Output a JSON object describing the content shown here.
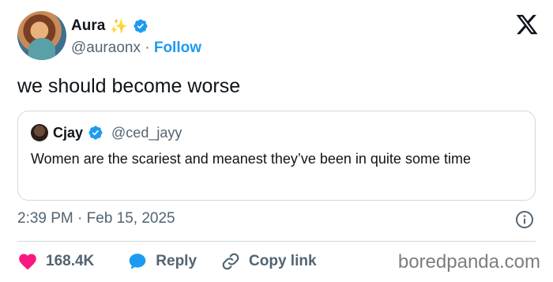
{
  "author": {
    "display_name": "Aura",
    "emoji": "✨",
    "handle": "@auraonx",
    "separator": "·",
    "follow_label": "Follow",
    "verified": true
  },
  "tweet": {
    "text": "we should become worse",
    "timestamp": "2:39 PM · Feb 15, 2025"
  },
  "quoted_tweet": {
    "display_name": "Cjay",
    "handle": "@ced_jayy",
    "verified": true,
    "text": "Women are the scariest and meanest they’ve been in quite some time"
  },
  "actions": {
    "likes_count": "168.4K",
    "reply_label": "Reply",
    "copy_link_label": "Copy link"
  },
  "watermark": "boredpanda.com",
  "colors": {
    "accent": "#1d9bf0",
    "like": "#f91880",
    "text_primary": "#0f1419",
    "text_secondary": "#536471",
    "border": "#cfd9de"
  },
  "icons": [
    "x-logo-icon",
    "verified-badge-icon",
    "heart-icon",
    "reply-bubble-icon",
    "link-icon",
    "info-icon"
  ]
}
